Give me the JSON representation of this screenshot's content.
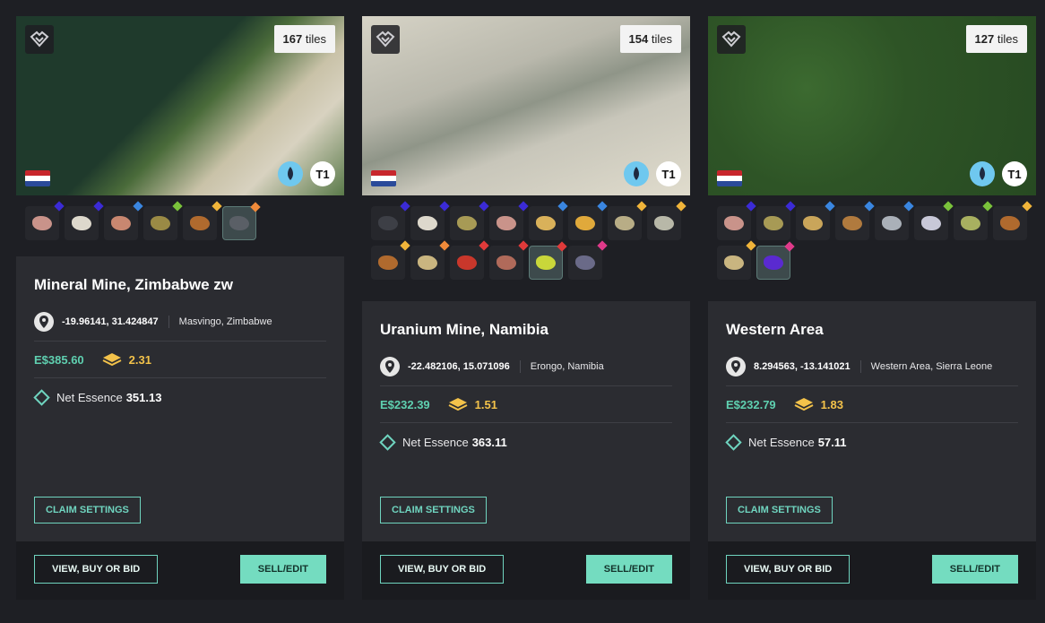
{
  "accent": "#74dcc0",
  "cards": [
    {
      "tiles_count": "167",
      "tiles_unit": "tiles",
      "tier": "T1",
      "name": "Mineral Mine, Zimbabwe zw",
      "coords": "-19.96141, 31.424847",
      "region": "Masvingo, Zimbabwe",
      "price": "E$385.60",
      "stake": "2.31",
      "essence_label": "Net Essence",
      "essence_value": "351.13",
      "claim_label": "CLAIM SETTINGS",
      "view_label": "VIEW, BUY OR BID",
      "sell_label": "SELL/EDIT",
      "minerals": [
        {
          "rock": "#c9938a",
          "gem": "#3b2bd6"
        },
        {
          "rock": "#ddd8cc",
          "gem": "#3b2bd6"
        },
        {
          "rock": "#c88770",
          "gem": "#3a86e0"
        },
        {
          "rock": "#9a8a45",
          "gem": "#7ac23b"
        },
        {
          "rock": "#b06a2e",
          "gem": "#f0b43a"
        },
        {
          "rock": "#5a5f66",
          "gem": "#f08a3a",
          "selected": true
        }
      ]
    },
    {
      "tiles_count": "154",
      "tiles_unit": "tiles",
      "tier": "T1",
      "name": "Uranium Mine, Namibia",
      "coords": "-22.482106, 15.071096",
      "region": "Erongo, Namibia",
      "price": "E$232.39",
      "stake": "1.51",
      "essence_label": "Net Essence",
      "essence_value": "363.11",
      "claim_label": "CLAIM SETTINGS",
      "view_label": "VIEW, BUY OR BID",
      "sell_label": "SELL/EDIT",
      "minerals": [
        {
          "rock": "#3d3f46",
          "gem": "#3b2bd6"
        },
        {
          "rock": "#ddd8cc",
          "gem": "#3b2bd6"
        },
        {
          "rock": "#a79a55",
          "gem": "#3b2bd6"
        },
        {
          "rock": "#c9938a",
          "gem": "#3b2bd6"
        },
        {
          "rock": "#d9b15a",
          "gem": "#3a86e0"
        },
        {
          "rock": "#e0a93b",
          "gem": "#3a86e0"
        },
        {
          "rock": "#b8ad86",
          "gem": "#f0b43a"
        },
        {
          "rock": "#b8b8a8",
          "gem": "#f0b43a"
        },
        {
          "rock": "#b06a2e",
          "gem": "#f0b43a"
        },
        {
          "rock": "#c9b580",
          "gem": "#f08a3a"
        },
        {
          "rock": "#c9372b",
          "gem": "#e03a3a"
        },
        {
          "rock": "#b06a5a",
          "gem": "#e03a3a"
        },
        {
          "rock": "#c9d73a",
          "gem": "#e03a3a",
          "selected": true
        },
        {
          "rock": "#6a6a88",
          "gem": "#e03a8a"
        }
      ]
    },
    {
      "tiles_count": "127",
      "tiles_unit": "tiles",
      "tier": "T1",
      "name": "Western Area",
      "coords": "8.294563, -13.141021",
      "region": "Western Area, Sierra Leone",
      "price": "E$232.79",
      "stake": "1.83",
      "essence_label": "Net Essence",
      "essence_value": "57.11",
      "claim_label": "CLAIM SETTINGS",
      "view_label": "VIEW, BUY OR BID",
      "sell_label": "SELL/EDIT",
      "minerals": [
        {
          "rock": "#c9938a",
          "gem": "#3b2bd6"
        },
        {
          "rock": "#a79a55",
          "gem": "#3b2bd6"
        },
        {
          "rock": "#c9a55a",
          "gem": "#3a86e0"
        },
        {
          "rock": "#b07a3e",
          "gem": "#3a86e0"
        },
        {
          "rock": "#aab0b8",
          "gem": "#3a86e0"
        },
        {
          "rock": "#c8c8d8",
          "gem": "#7ac23b"
        },
        {
          "rock": "#a8b060",
          "gem": "#7ac23b"
        },
        {
          "rock": "#b06a2e",
          "gem": "#f0b43a"
        },
        {
          "rock": "#c9b580",
          "gem": "#f0b43a"
        },
        {
          "rock": "#5a2ad0",
          "gem": "#e03a8a",
          "selected": true
        }
      ]
    }
  ]
}
